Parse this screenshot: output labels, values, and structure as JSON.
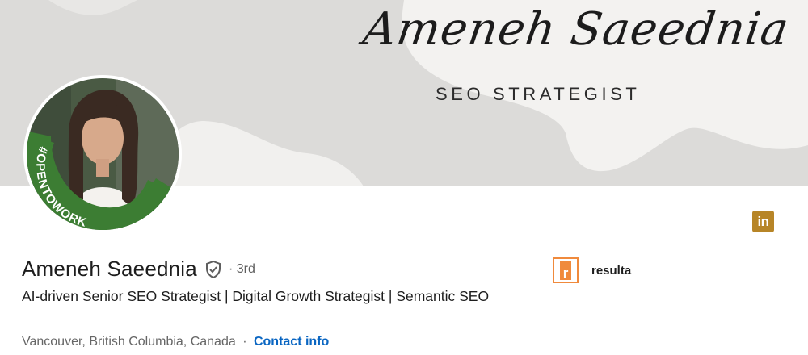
{
  "banner": {
    "name_script": "Ameneh Saeednia",
    "title": "SEO STRATEGIST"
  },
  "profile": {
    "badge_text": "#OPENTOWORK",
    "name": "Ameneh Saeednia",
    "degree": "· 3rd",
    "headline": "AI-driven Senior SEO Strategist | Digital Growth Strategist | Semantic SEO",
    "location": "Vancouver, British Columbia, Canada",
    "separator": "·",
    "contact_label": "Contact info"
  },
  "company": {
    "logo_letter": "r",
    "name": "resulta",
    "accent": "#f08a3c"
  },
  "icons": {
    "linkedin": "linkedin-icon",
    "verified": "verified-shield-icon"
  },
  "colors": {
    "link": "#0a66c2",
    "open_to_work_green": "#3c7d33",
    "linkedin_badge": "#b78527"
  },
  "linkedin_badge_text": "in"
}
